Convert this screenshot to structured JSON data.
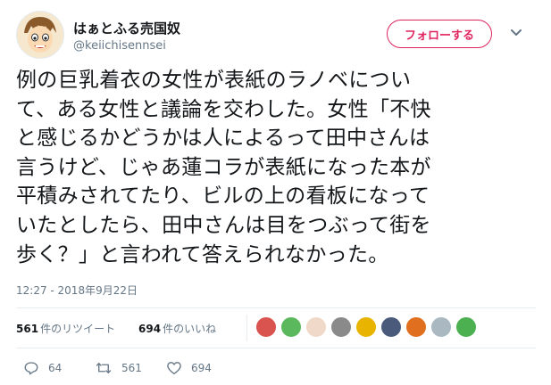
{
  "author": {
    "display_name": "はぁとふる売国奴",
    "handle": "@keiichisennsei",
    "avatar_icon": "cartoon-face-avatar"
  },
  "follow_button": {
    "label": "フォローする",
    "color": "#e0245e"
  },
  "tweet": {
    "lines": [
      "例の巨乳着衣の女性が表紙のラノベについ",
      "て、ある女性と議論を交わした。女性「不快",
      "と感じるかどうかは人によるって田中さんは",
      "言うけど、じゃあ蓮コラが表紙になった本が",
      "平積みされてたり、ビルの上の看板になって",
      "いたとしたら、田中さんは目をつぶって街を",
      "歩く？」と言われて答えられなかった。"
    ],
    "timestamp": "12:27 - 2018年9月22日"
  },
  "stats": {
    "retweets_count": "561",
    "retweets_label": "件のリツイート",
    "likes_count": "694",
    "likes_label": "件のいいね"
  },
  "likers": [
    {
      "icon": "liker-avatar-1",
      "color": "#d9534f"
    },
    {
      "icon": "liker-avatar-2",
      "color": "#5cb85c"
    },
    {
      "icon": "liker-avatar-3",
      "color": "#f0d9c8"
    },
    {
      "icon": "liker-avatar-4",
      "color": "#8a8a8a"
    },
    {
      "icon": "liker-avatar-5",
      "color": "#e8b400"
    },
    {
      "icon": "liker-avatar-6",
      "color": "#4a5a7a"
    },
    {
      "icon": "liker-avatar-7",
      "color": "#e07020"
    },
    {
      "icon": "liker-avatar-8",
      "color": "#aab8c2"
    },
    {
      "icon": "liker-avatar-9",
      "color": "#4caf50"
    }
  ],
  "actions": {
    "reply_count": "64",
    "retweet_count": "561",
    "like_count": "694"
  }
}
